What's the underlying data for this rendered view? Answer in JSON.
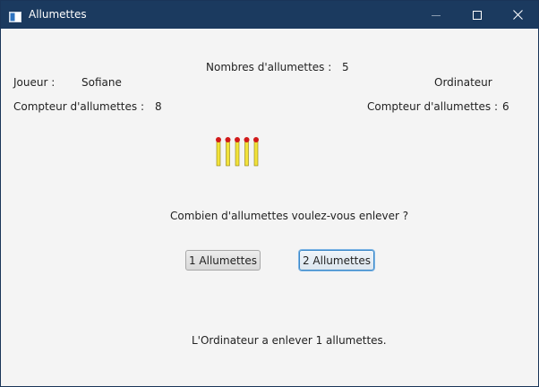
{
  "window": {
    "title": "Allumettes"
  },
  "header": {
    "nombres_label": "Nombres d'allumettes :",
    "nombres_value": "5"
  },
  "joueur": {
    "label": "Joueur :",
    "name": "Sofiane",
    "counter_label": "Compteur d'allumettes :",
    "counter_value": "8"
  },
  "ordinateur": {
    "name": "Ordinateur",
    "counter_label": "Compteur d'allumettes :",
    "counter_value": "6"
  },
  "board": {
    "matches_remaining": 5,
    "match_stick_color": "#f2e23a",
    "match_head_color": "#d11a1a"
  },
  "question": "Combien d'allumettes voulez-vous enlever ?",
  "buttons": {
    "one_label": "1 Allumettes",
    "two_label": "2 Allumettes"
  },
  "status": "L'Ordinateur a enlever 1 allumettes."
}
